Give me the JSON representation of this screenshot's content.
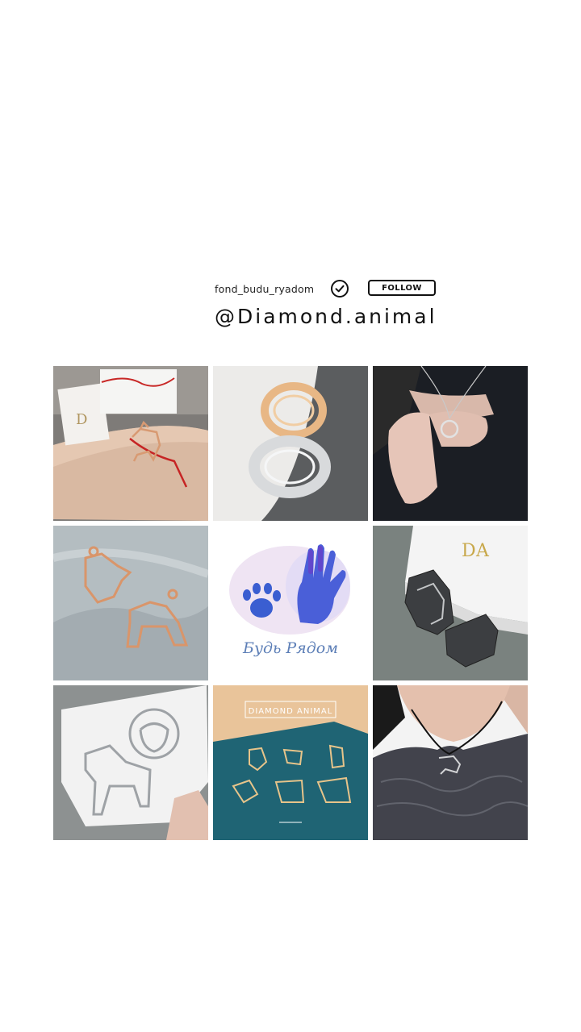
{
  "profile": {
    "username": "fond_budu_ryadom",
    "follow_label": "FOLLOW",
    "handle": "@Diamond.animal",
    "verified_icon": "check-circle-icon"
  },
  "grid": {
    "posts": [
      {
        "subject": "rose-gold dog bracelet on red string",
        "bg": "#8a8580"
      },
      {
        "subject": "gold and silver dog rings",
        "bg": "#e9e6e2"
      },
      {
        "subject": "silver pug pendant in hand",
        "bg": "#1e2228"
      },
      {
        "subject": "rose-gold dog pendants on fabric",
        "bg": "#b4bcbf"
      },
      {
        "subject": "watercolor paw and hand print logo",
        "bg": "#ffffff",
        "logo_text": "Будь Рядом"
      },
      {
        "subject": "dark steel dog pendants with DA box",
        "bg": "#7e8683"
      },
      {
        "subject": "silver bulldog pendants on cloth",
        "bg": "#c8cacc"
      },
      {
        "subject": "gold dog pendants promo card",
        "bg": "#1f6474",
        "promo_title": "DIAMOND ANIMAL"
      },
      {
        "subject": "dog pendant on black cord",
        "bg": "#3a3b44"
      }
    ]
  }
}
